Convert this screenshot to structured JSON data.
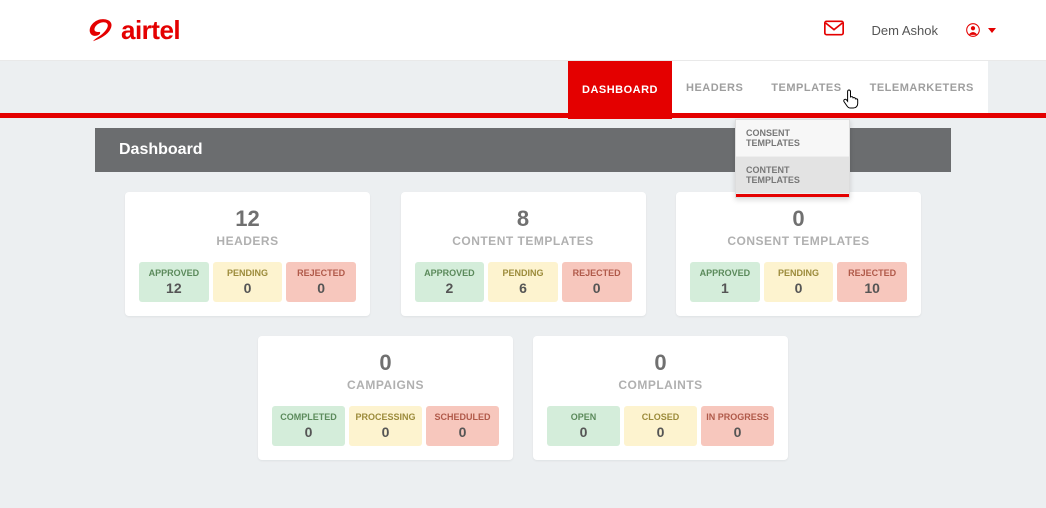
{
  "brand": {
    "name": "airtel"
  },
  "user": {
    "name": "Dem Ashok"
  },
  "nav": {
    "items": [
      {
        "label": "DASHBOARD",
        "active": true
      },
      {
        "label": "HEADERS"
      },
      {
        "label": "TEMPLATES"
      },
      {
        "label": "TELEMARKETERS"
      }
    ],
    "dropdown": {
      "items": [
        {
          "label": "CONSENT TEMPLATES"
        },
        {
          "label": "CONTENT TEMPLATES",
          "hover": true
        }
      ]
    }
  },
  "page": {
    "title": "Dashboard"
  },
  "cards": {
    "headers": {
      "count": "12",
      "label": "HEADERS",
      "approved": {
        "label": "APPROVED",
        "value": "12"
      },
      "pending": {
        "label": "PENDING",
        "value": "0"
      },
      "rejected": {
        "label": "REJECTED",
        "value": "0"
      }
    },
    "content_templates": {
      "count": "8",
      "label": "CONTENT TEMPLATES",
      "approved": {
        "label": "APPROVED",
        "value": "2"
      },
      "pending": {
        "label": "PENDING",
        "value": "6"
      },
      "rejected": {
        "label": "REJECTED",
        "value": "0"
      }
    },
    "consent_templates": {
      "count": "0",
      "label": "CONSENT TEMPLATES",
      "approved": {
        "label": "APPROVED",
        "value": "1"
      },
      "pending": {
        "label": "PENDING",
        "value": "0"
      },
      "rejected": {
        "label": "REJECTED",
        "value": "10"
      }
    },
    "campaigns": {
      "count": "0",
      "label": "CAMPAIGNS",
      "completed": {
        "label": "COMPLETED",
        "value": "0"
      },
      "processing": {
        "label": "PROCESSING",
        "value": "0"
      },
      "scheduled": {
        "label": "SCHEDULED",
        "value": "0"
      }
    },
    "complaints": {
      "count": "0",
      "label": "COMPLAINTS",
      "open": {
        "label": "OPEN",
        "value": "0"
      },
      "closed": {
        "label": "CLOSED",
        "value": "0"
      },
      "inprogress": {
        "label": "IN PROGRESS",
        "value": "0"
      }
    }
  }
}
